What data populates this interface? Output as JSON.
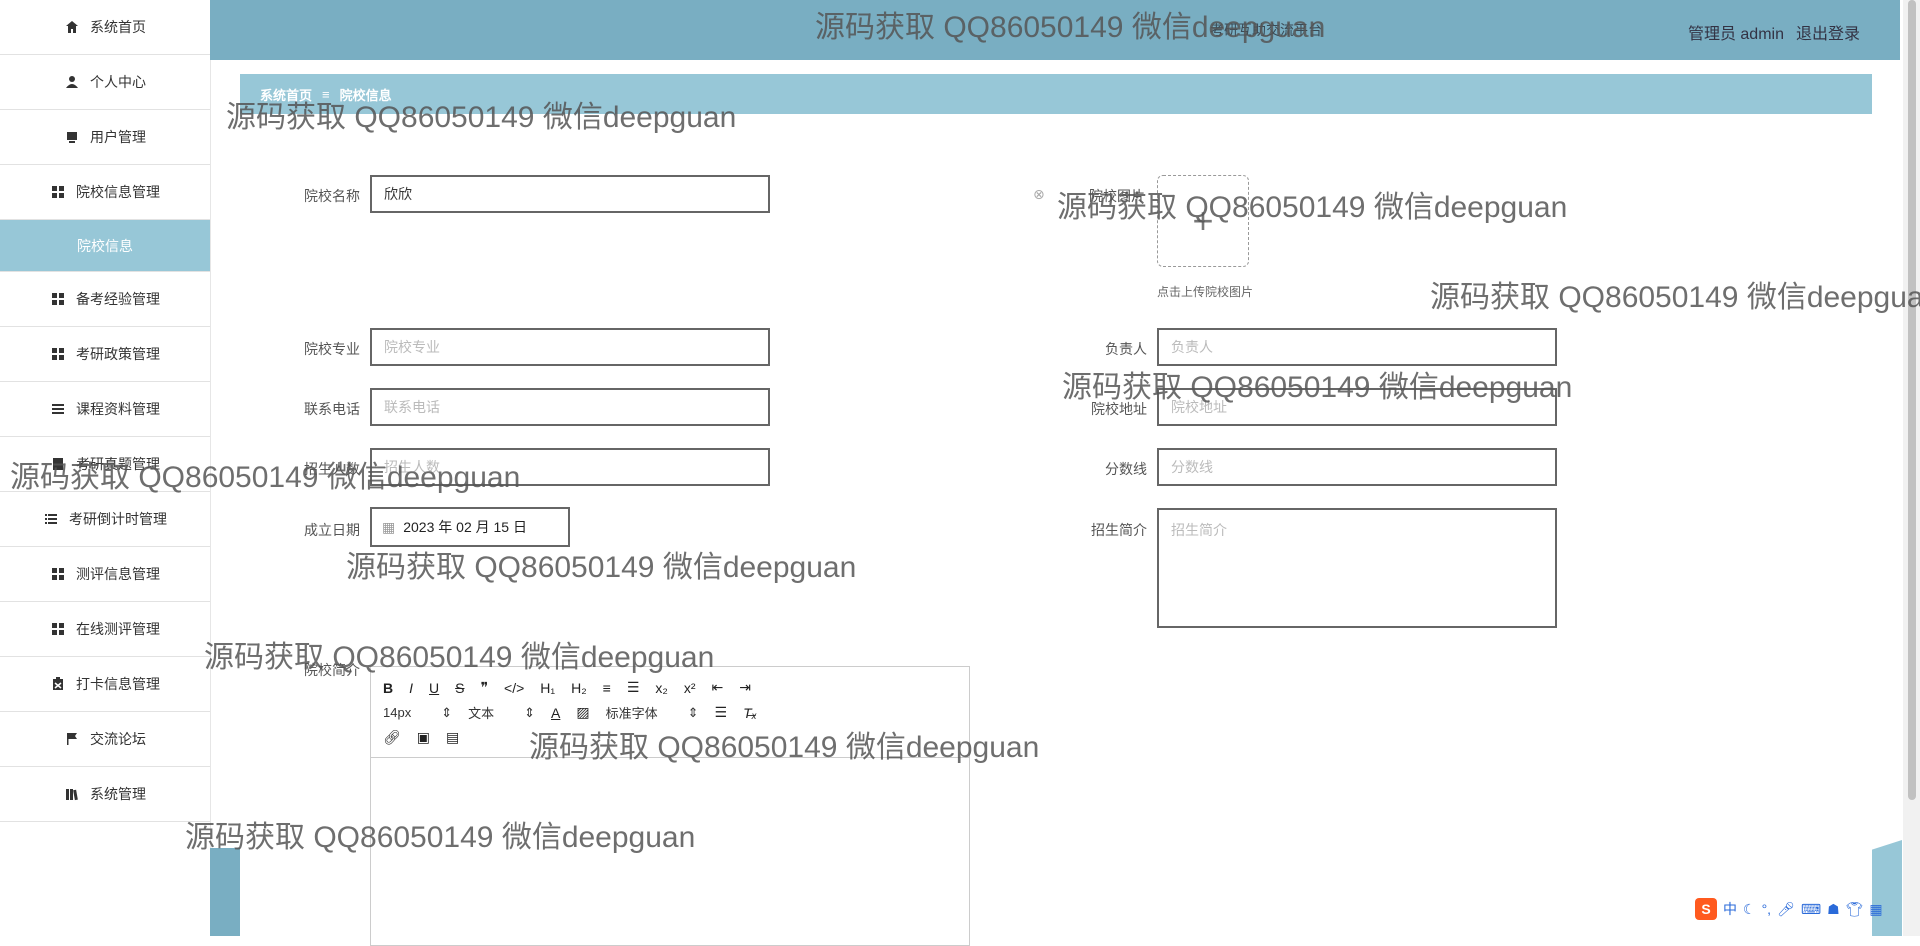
{
  "sidebar": {
    "items": [
      {
        "label": "系统首页",
        "icon": "home-icon"
      },
      {
        "label": "个人中心",
        "icon": "user-icon"
      },
      {
        "label": "用户管理",
        "icon": "monitor-icon"
      },
      {
        "label": "院校信息管理",
        "icon": "grid-icon"
      },
      {
        "label": "院校信息",
        "icon": ""
      },
      {
        "label": "备考经验管理",
        "icon": "grid-icon"
      },
      {
        "label": "考研政策管理",
        "icon": "grid-icon"
      },
      {
        "label": "课程资料管理",
        "icon": "list-icon"
      },
      {
        "label": "考研真题管理",
        "icon": "book-icon"
      },
      {
        "label": "考研倒计时管理",
        "icon": "list-icon"
      },
      {
        "label": "测评信息管理",
        "icon": "grid-icon"
      },
      {
        "label": "在线测评管理",
        "icon": "grid-icon"
      },
      {
        "label": "打卡信息管理",
        "icon": "clipboard-icon"
      },
      {
        "label": "交流论坛",
        "icon": "flag-icon"
      },
      {
        "label": "系统管理",
        "icon": "books-icon"
      }
    ]
  },
  "header": {
    "title": "考研互助交流平台",
    "user": "管理员 admin",
    "logout": "退出登录"
  },
  "breadcrumb": {
    "home": "系统首页",
    "current": "院校信息"
  },
  "form": {
    "school_name_label": "院校名称",
    "school_name_value": "欣欣",
    "school_image_label": "院校图片",
    "upload_hint": "点击上传院校图片",
    "major_label": "院校专业",
    "major_placeholder": "院校专业",
    "person_label": "负责人",
    "person_placeholder": "负责人",
    "phone_label": "联系电话",
    "phone_placeholder": "联系电话",
    "address_label": "院校地址",
    "address_placeholder": "院校地址",
    "enroll_label": "招生人数",
    "enroll_placeholder": "招生人数",
    "score_label": "分数线",
    "score_placeholder": "分数线",
    "date_label": "成立日期",
    "date_value": "2023 年 02 月 15 日",
    "intro_label": "招生简介",
    "intro_placeholder": "招生简介",
    "school_intro_label": "院校简介"
  },
  "editor": {
    "row1": [
      "B",
      "I",
      "U",
      "S",
      "❞",
      "</>",
      "H₁",
      "H₂",
      "≡",
      "☰",
      "x₂",
      "x²",
      "⇤",
      "⇥"
    ],
    "font_size": "14px",
    "text_type": "文本",
    "font_family": "标准字体"
  },
  "watermark": "源码获取 QQ86050149 微信deepguan",
  "ime": {
    "lang": "中"
  }
}
